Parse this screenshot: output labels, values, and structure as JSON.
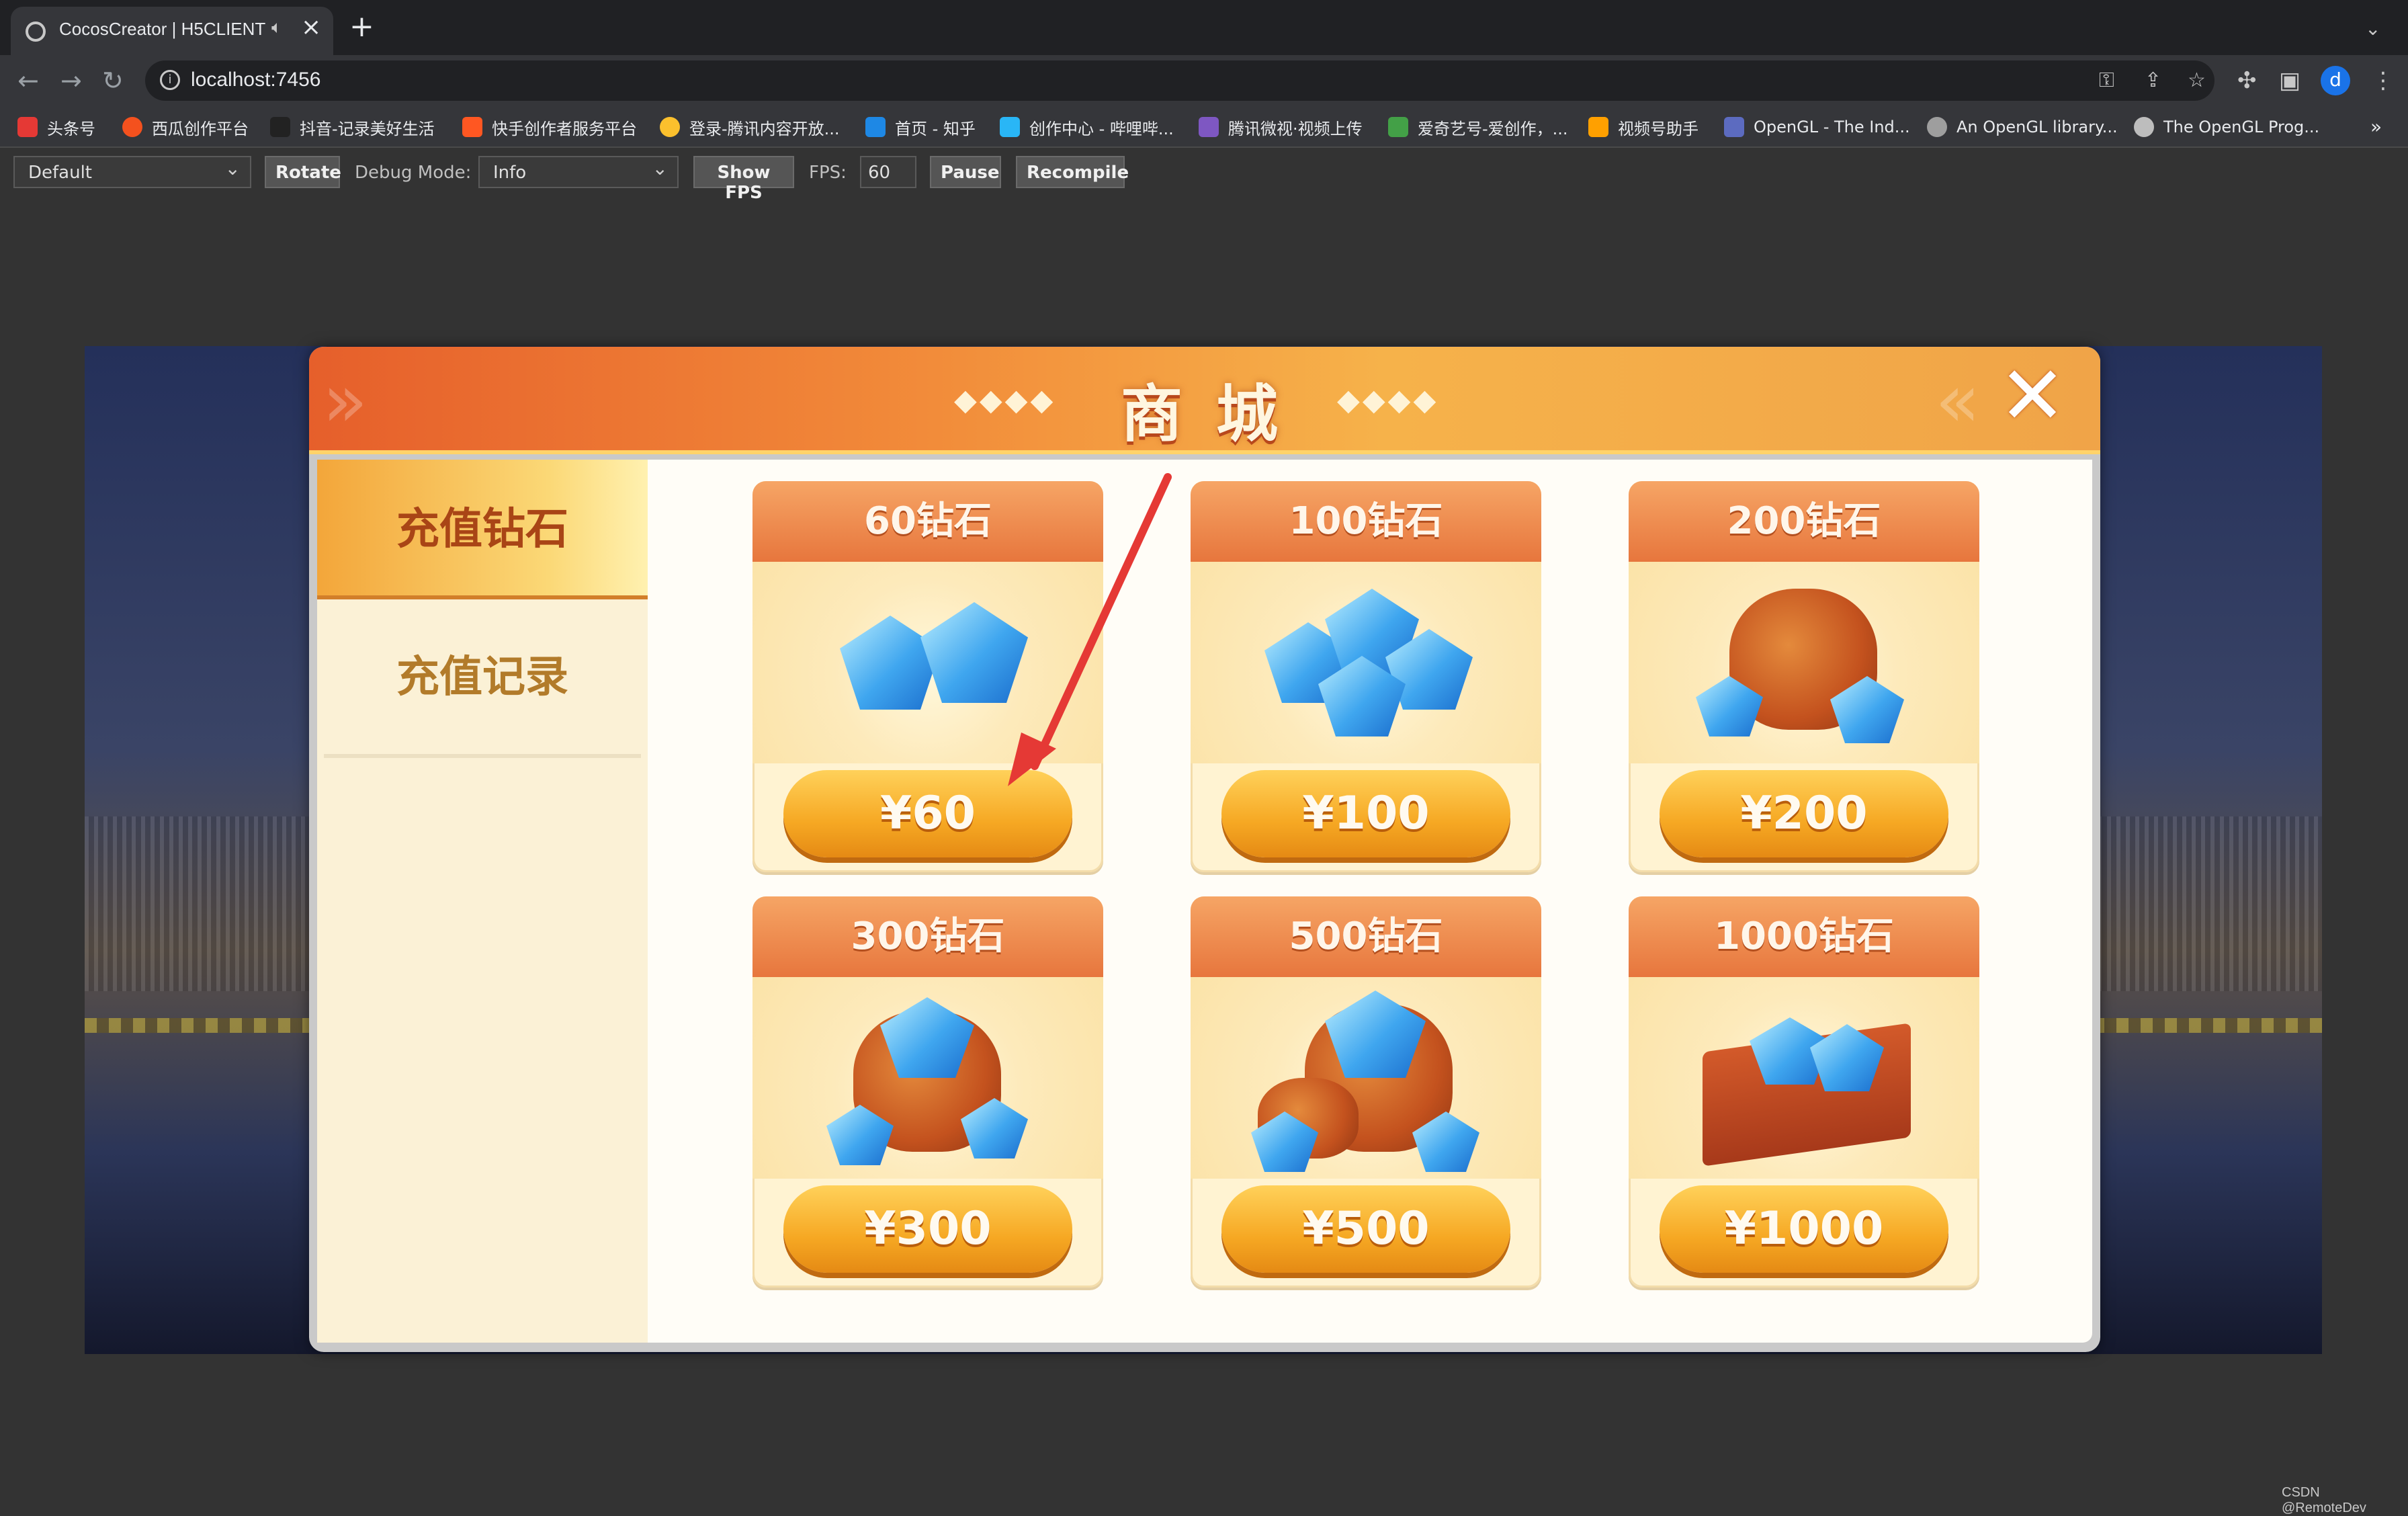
{
  "browser": {
    "tab_title": "CocosCreator | H5CLIENT",
    "url": "localhost:7456",
    "profile_initial": "d",
    "bookmarks": [
      {
        "label": "头条号",
        "color": "#e53935"
      },
      {
        "label": "西瓜创作平台",
        "color": "#f4511e"
      },
      {
        "label": "抖音-记录美好生活",
        "color": "#222222"
      },
      {
        "label": "快手创作者服务平台",
        "color": "#ff5722"
      },
      {
        "label": "登录-腾讯内容开放...",
        "color": "#fbc02d"
      },
      {
        "label": "首页 - 知乎",
        "color": "#1e88e5"
      },
      {
        "label": "创作中心 - 哔哩哔...",
        "color": "#29b6f6"
      },
      {
        "label": "腾讯微视·视频上传",
        "color": "#7e57c2"
      },
      {
        "label": "爱奇艺号-爱创作，...",
        "color": "#43a047"
      },
      {
        "label": "视频号助手",
        "color": "#ffa000"
      },
      {
        "label": "OpenGL - The Ind...",
        "color": "#5c6bc0"
      },
      {
        "label": "An OpenGL library...",
        "color": "#9e9e9e"
      },
      {
        "label": "The OpenGL Prog...",
        "color": "#bdbdbd"
      }
    ],
    "more_label": "»"
  },
  "cocos_toolbar": {
    "device_select": "Default",
    "rotate_label": "Rotate",
    "debug_mode_label": "Debug Mode:",
    "debug_mode_value": "Info",
    "show_fps_label": "Show FPS",
    "fps_label": "FPS:",
    "fps_value": "60",
    "pause_label": "Pause",
    "recompile_label": "Recompile"
  },
  "shop": {
    "title": "商城",
    "title_deco_left": "◆◆◆◆",
    "title_deco_right": "◆◆◆◆",
    "sidebar": {
      "active_tab": "充值钻石",
      "inactive_tab": "充值记录"
    },
    "items": [
      {
        "name": "60钻石",
        "price": "¥60",
        "art": "gems-small"
      },
      {
        "name": "100钻石",
        "price": "¥100",
        "art": "gems-pile"
      },
      {
        "name": "200钻石",
        "price": "¥200",
        "art": "bag-small"
      },
      {
        "name": "300钻石",
        "price": "¥300",
        "art": "bag-medium"
      },
      {
        "name": "500钻石",
        "price": "¥500",
        "art": "bag-large"
      },
      {
        "name": "1000钻石",
        "price": "¥1000",
        "art": "treasure-chest"
      }
    ]
  },
  "annotation": {
    "color": "#e53935"
  },
  "watermark": "CSDN @RemoteDev"
}
